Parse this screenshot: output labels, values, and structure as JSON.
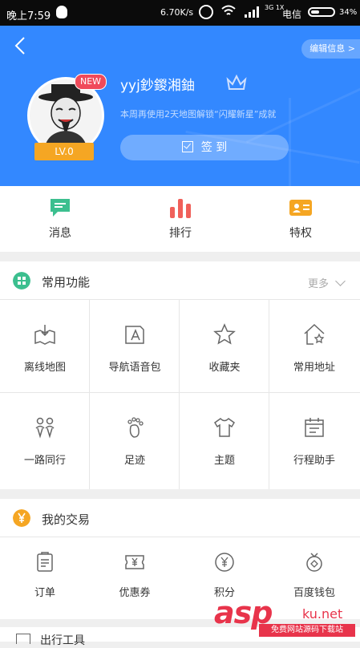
{
  "status_bar": {
    "time": "晚上7:59",
    "speed": "6.70K/s",
    "network": "3G 1X",
    "carrier": "电信",
    "battery": "34%"
  },
  "header": {
    "edit_label": "编辑信息 >",
    "new_badge": "NEW",
    "level": "LV.0",
    "username": "yyj鈔鍐湘鈾",
    "hint": "本周再使用2天地图解锁“闪耀新星”成就",
    "signin_label": "签 到"
  },
  "top_actions": [
    {
      "label": "消息",
      "icon": "message-icon",
      "color": "#3cbf8f"
    },
    {
      "label": "排行",
      "icon": "ranking-icon",
      "color": "#f0605a"
    },
    {
      "label": "特权",
      "icon": "privilege-card-icon",
      "color": "#f5a623"
    }
  ],
  "common": {
    "title": "常用功能",
    "more": "更多",
    "items": [
      {
        "label": "离线地图",
        "icon": "offline-map-icon"
      },
      {
        "label": "导航语音包",
        "icon": "voice-package-icon"
      },
      {
        "label": "收藏夹",
        "icon": "star-icon"
      },
      {
        "label": "常用地址",
        "icon": "home-star-icon"
      },
      {
        "label": "一路同行",
        "icon": "companions-icon"
      },
      {
        "label": "足迹",
        "icon": "footprint-icon"
      },
      {
        "label": "主题",
        "icon": "tshirt-icon"
      },
      {
        "label": "行程助手",
        "icon": "calendar-icon"
      }
    ]
  },
  "trade": {
    "title": "我的交易",
    "items": [
      {
        "label": "订单",
        "icon": "order-icon"
      },
      {
        "label": "优惠券",
        "icon": "coupon-icon"
      },
      {
        "label": "积分",
        "icon": "points-icon"
      },
      {
        "label": "百度钱包",
        "icon": "wallet-icon"
      }
    ]
  },
  "bottom": {
    "label": "出行工具"
  },
  "watermark": {
    "brand": "asp",
    "domain": "ku.net",
    "sub": "免费网站源码下载站"
  }
}
